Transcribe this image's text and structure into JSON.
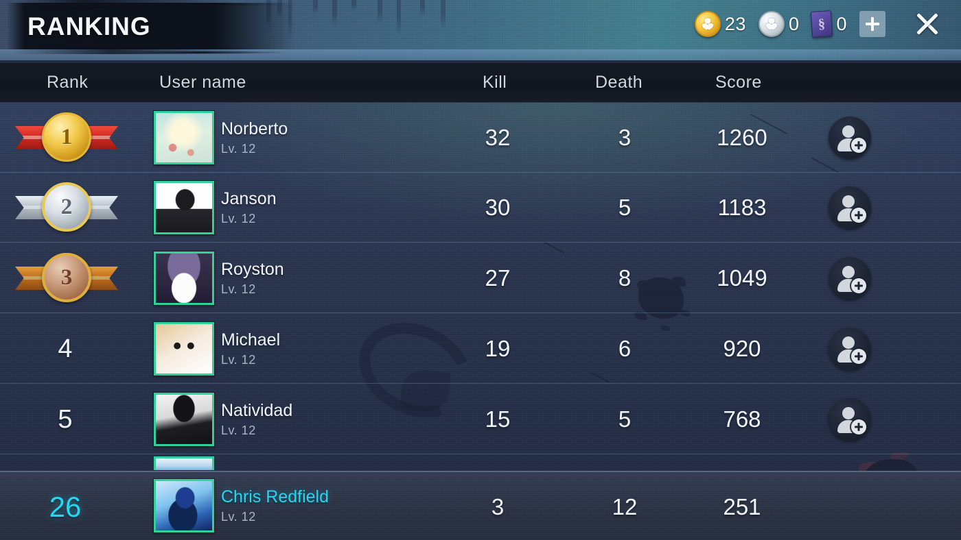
{
  "header": {
    "title": "RANKING",
    "currencies": [
      {
        "icon": "gold-coin-icon",
        "value": "23"
      },
      {
        "icon": "silver-coin-icon",
        "value": "0"
      },
      {
        "icon": "purple-card-icon",
        "value": "0",
        "glyph": "§"
      }
    ],
    "add_currency_label": "+",
    "close_label": "✕"
  },
  "table": {
    "columns": {
      "rank": "Rank",
      "user": "User name",
      "kill": "Kill",
      "death": "Death",
      "score": "Score"
    },
    "rows": [
      {
        "rank": "1",
        "medal": "gold",
        "name": "Norberto",
        "level": "Lv. 12",
        "kill": "32",
        "death": "3",
        "score": "1260"
      },
      {
        "rank": "2",
        "medal": "silver",
        "name": "Janson",
        "level": "Lv. 12",
        "kill": "30",
        "death": "5",
        "score": "1183"
      },
      {
        "rank": "3",
        "medal": "bronze",
        "name": "Royston",
        "level": "Lv. 12",
        "kill": "27",
        "death": "8",
        "score": "1049"
      },
      {
        "rank": "4",
        "medal": "none",
        "name": "Michael",
        "level": "Lv. 12",
        "kill": "19",
        "death": "6",
        "score": "920"
      },
      {
        "rank": "5",
        "medal": "none",
        "name": "Natividad",
        "level": "Lv. 12",
        "kill": "15",
        "death": "5",
        "score": "768"
      }
    ],
    "self_row": {
      "rank": "26",
      "name": "Chris Redfield",
      "level": "Lv. 12",
      "kill": "3",
      "death": "12",
      "score": "251"
    }
  },
  "colors": {
    "accent_cyan": "#24d7f2",
    "avatar_border": "#2fd39a",
    "gold": "#f2c94c",
    "silver": "#d6dde3",
    "bronze": "#c99b7d",
    "ribbon_red": "#d42a22",
    "background_navy": "#2c3752"
  }
}
